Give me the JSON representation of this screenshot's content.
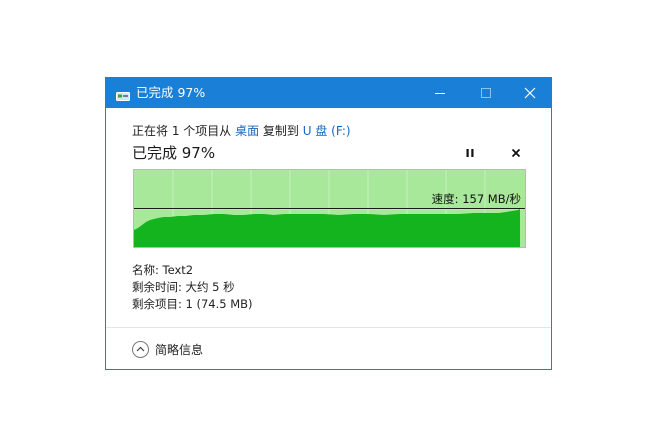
{
  "window": {
    "title": "已完成 97%",
    "minimize_glyph": "—",
    "maximize_glyph": "☐",
    "close_glyph": "✕"
  },
  "copy": {
    "prefix": "正在将 1 个项目从 ",
    "source": "桌面",
    "middle": " 复制到 ",
    "destination": "U 盘 (F:)",
    "progress_title": "已完成 97%",
    "percent_complete": 97,
    "speed_label": "速度: 157 MB/秒"
  },
  "details": {
    "name": "名称: Text2",
    "time_remaining": "剩余时间: 大约 5 秒",
    "items_remaining": "剩余项目: 1 (74.5 MB)"
  },
  "footer": {
    "more_label": "简略信息"
  },
  "colors": {
    "accent": "#1a7fd6",
    "graph_background": "#a8e89a",
    "graph_fill": "#14b41e",
    "link": "#1a66c0"
  },
  "icons": {
    "app": "drive-copy-icon",
    "pause": "pause-icon",
    "cancel": "close-icon",
    "toggle": "chevron-up-icon"
  }
}
